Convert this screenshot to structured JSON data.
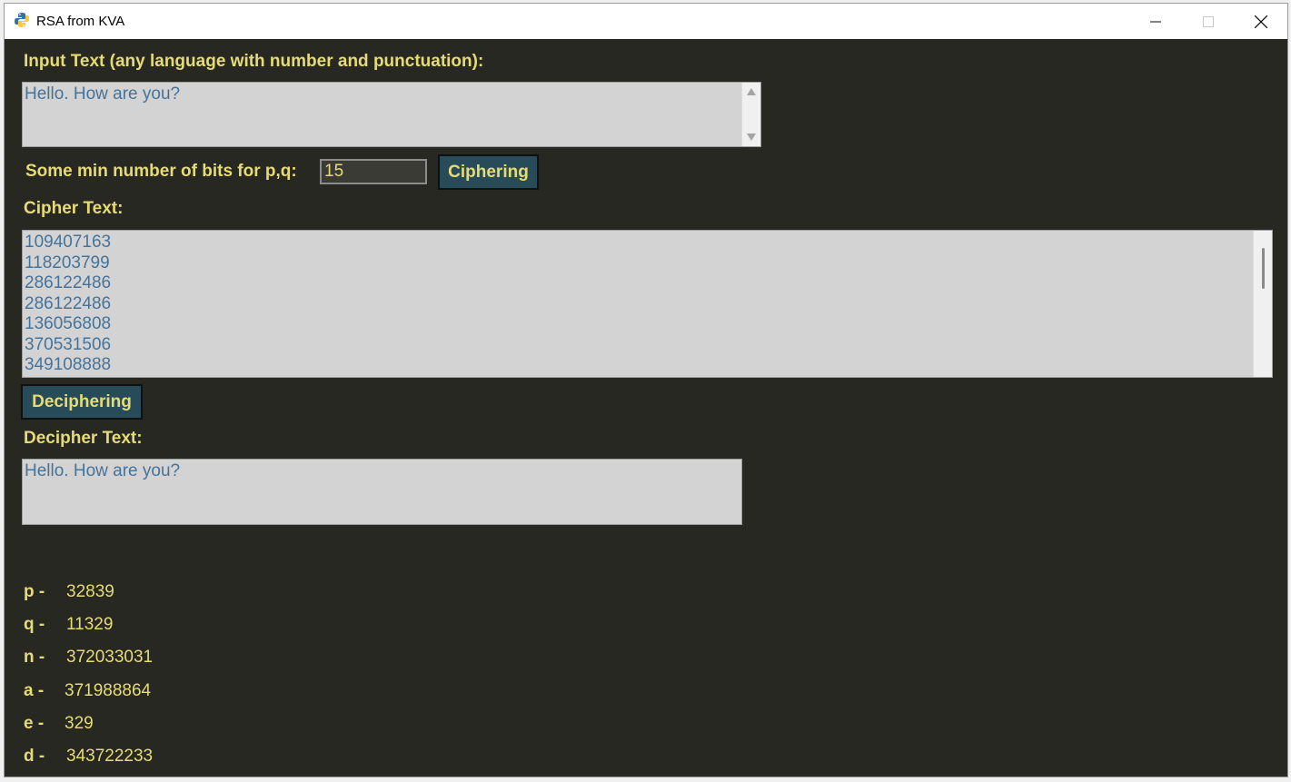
{
  "window": {
    "title": "RSA from KVA"
  },
  "input": {
    "label": "Input Text (any language with number and punctuation):",
    "text": "Hello. How are you?"
  },
  "bits": {
    "label": "Some min number of bits for p,q:",
    "value": "15"
  },
  "buttons": {
    "cipher": "Ciphering",
    "decipher": "Deciphering"
  },
  "cipher": {
    "label": "Cipher Text:",
    "lines": [
      "109407163",
      "118203799",
      "286122486",
      "286122486",
      "136056808",
      "370531506",
      "349108888"
    ]
  },
  "decipher": {
    "label": "Decipher Text:",
    "text": "Hello. How are you?"
  },
  "params": [
    {
      "key": "p -",
      "value": "32839"
    },
    {
      "key": "q -",
      "value": "11329"
    },
    {
      "key": "n -",
      "value": "372033031"
    },
    {
      "key": "a -",
      "value": "371988864"
    },
    {
      "key": "e -",
      "value": "329"
    },
    {
      "key": "d -",
      "value": "343722233"
    }
  ]
}
